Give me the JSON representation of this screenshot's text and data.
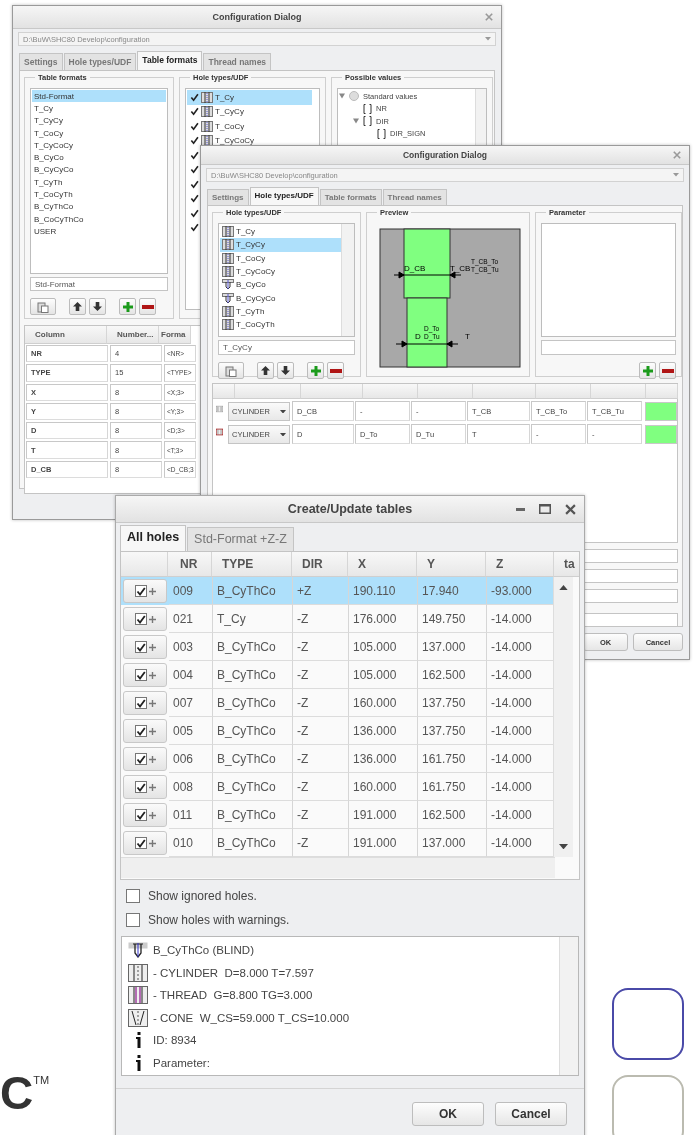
{
  "dialog_back": {
    "title": "Configuration Dialog",
    "path": "D:\\BuW\\SHC80 Develop\\configuration",
    "tabs": [
      {
        "label": "Settings",
        "selected": false
      },
      {
        "label": "Hole types/UDF",
        "selected": false
      },
      {
        "label": "Table formats",
        "selected": true
      },
      {
        "label": "Thread names",
        "selected": false
      }
    ],
    "table_formats": {
      "title": "Table formats",
      "name_value": "Std-Format",
      "items": [
        {
          "label": "Std-Format",
          "selected": true
        },
        {
          "label": "T_Cy",
          "selected": false
        },
        {
          "label": "T_CyCy",
          "selected": false
        },
        {
          "label": "T_CoCy",
          "selected": false
        },
        {
          "label": "T_CyCoCy",
          "selected": false
        },
        {
          "label": "B_CyCo",
          "selected": false
        },
        {
          "label": "B_CyCyCo",
          "selected": false
        },
        {
          "label": "T_CyTh",
          "selected": false
        },
        {
          "label": "T_CoCyTh",
          "selected": false
        },
        {
          "label": "B_CyThCo",
          "selected": false
        },
        {
          "label": "B_CoCyThCo",
          "selected": false
        },
        {
          "label": "USER",
          "selected": false
        }
      ]
    },
    "hole_types": {
      "title": "Hole types/UDF",
      "items": [
        {
          "label": "T_Cy",
          "kind": "through",
          "checked": true,
          "selected": true
        },
        {
          "label": "T_CyCy",
          "kind": "through",
          "checked": true,
          "selected": false
        },
        {
          "label": "T_CoCy",
          "kind": "through",
          "checked": true,
          "selected": false
        },
        {
          "label": "T_CyCoCy",
          "kind": "through",
          "checked": true,
          "selected": false
        },
        {
          "checked": true,
          "selected": false
        },
        {
          "checked": true,
          "selected": false
        },
        {
          "checked": true,
          "selected": false
        },
        {
          "checked": true,
          "selected": false
        },
        {
          "checked": true,
          "selected": false
        },
        {
          "checked": true,
          "selected": false
        }
      ]
    },
    "possible_values": {
      "title": "Possible values",
      "tree": [
        {
          "label": "Standard values",
          "expanded": true,
          "children": [
            {
              "label": "NR"
            },
            {
              "label": "DIR",
              "expanded": true,
              "children": [
                {
                  "label": "DIR_SIGN"
                }
              ]
            }
          ]
        }
      ]
    },
    "columns_table": {
      "columns": [
        "Column",
        "Number...",
        "Forma"
      ],
      "rows": [
        [
          "NR",
          "4",
          "<NR>"
        ],
        [
          "TYPE",
          "15",
          "<TYPE>"
        ],
        [
          "X",
          "8",
          "<X;3>"
        ],
        [
          "Y",
          "8",
          "<Y;3>"
        ],
        [
          "D",
          "8",
          "<D;3>"
        ],
        [
          "T",
          "8",
          "<T;3>"
        ],
        [
          "D_CB",
          "8",
          "<D_CB;3"
        ]
      ]
    }
  },
  "dialog_middle": {
    "title": "Configuration Dialog",
    "path": "D:\\BuW\\SHC80 Develop\\configuration",
    "tabs": [
      {
        "label": "Settings",
        "selected": false
      },
      {
        "label": "Hole types/UDF",
        "selected": true
      },
      {
        "label": "Table formats",
        "selected": false
      },
      {
        "label": "Thread names",
        "selected": false
      }
    ],
    "hole_types": {
      "title": "Hole types/UDF",
      "name_value": "T_CyCy",
      "items": [
        {
          "label": "T_Cy",
          "kind": "through",
          "selected": false
        },
        {
          "label": "T_CyCy",
          "kind": "through",
          "selected": true
        },
        {
          "label": "T_CoCy",
          "kind": "through",
          "selected": false
        },
        {
          "label": "T_CyCoCy",
          "kind": "through",
          "selected": false
        },
        {
          "label": "B_CyCo",
          "kind": "blind",
          "selected": false
        },
        {
          "label": "B_CyCyCo",
          "kind": "blind",
          "selected": false
        },
        {
          "label": "T_CyTh",
          "kind": "through",
          "selected": false
        },
        {
          "label": "T_CoCyTh",
          "kind": "through",
          "selected": false
        }
      ]
    },
    "preview": {
      "title": "Preview",
      "labels": [
        "D_CB",
        "T_CB",
        "T_CB_To",
        "T_CB_Tu",
        "D",
        "D_To",
        "D_Tu",
        "T"
      ]
    },
    "parameter": {
      "title": "Parameter"
    },
    "segments": [
      {
        "selected": false,
        "shape": "CYLINDER",
        "cells": [
          "D_CB",
          "-",
          "-",
          "T_CB",
          "T_CB_To",
          "T_CB_Tu"
        ]
      },
      {
        "selected": true,
        "shape": "CYLINDER",
        "cells": [
          "D",
          "D_To",
          "D_Tu",
          "T",
          "-",
          "-"
        ]
      }
    ],
    "buttons": [
      "OK",
      "Cancel"
    ]
  },
  "create_tables": {
    "title": "Create/Update tables",
    "tabs": [
      {
        "label": "All holes",
        "selected": true
      },
      {
        "label": "Std-Format +Z-Z",
        "selected": false
      }
    ],
    "columns": [
      "NR",
      "TYPE",
      "DIR",
      "X",
      "Y",
      "Z",
      "ta"
    ],
    "rows": [
      {
        "checked": true,
        "selected": true,
        "cells": [
          "009",
          "B_CyThCo",
          "+Z",
          "190.110",
          "17.940",
          "-93.000"
        ]
      },
      {
        "checked": true,
        "selected": false,
        "cells": [
          "021",
          "T_Cy",
          "-Z",
          "176.000",
          "149.750",
          "-14.000"
        ]
      },
      {
        "checked": true,
        "selected": false,
        "cells": [
          "003",
          "B_CyThCo",
          "-Z",
          "105.000",
          "137.000",
          "-14.000"
        ]
      },
      {
        "checked": true,
        "selected": false,
        "cells": [
          "004",
          "B_CyThCo",
          "-Z",
          "105.000",
          "162.500",
          "-14.000"
        ]
      },
      {
        "checked": true,
        "selected": false,
        "cells": [
          "007",
          "B_CyThCo",
          "-Z",
          "160.000",
          "137.750",
          "-14.000"
        ]
      },
      {
        "checked": true,
        "selected": false,
        "cells": [
          "005",
          "B_CyThCo",
          "-Z",
          "136.000",
          "137.750",
          "-14.000"
        ]
      },
      {
        "checked": true,
        "selected": false,
        "cells": [
          "006",
          "B_CyThCo",
          "-Z",
          "136.000",
          "161.750",
          "-14.000"
        ]
      },
      {
        "checked": true,
        "selected": false,
        "cells": [
          "008",
          "B_CyThCo",
          "-Z",
          "160.000",
          "161.750",
          "-14.000"
        ]
      },
      {
        "checked": true,
        "selected": false,
        "cells": [
          "011",
          "B_CyThCo",
          "-Z",
          "191.000",
          "162.500",
          "-14.000"
        ]
      },
      {
        "checked": true,
        "selected": false,
        "cells": [
          "010",
          "B_CyThCo",
          "-Z",
          "191.000",
          "137.000",
          "-14.000"
        ]
      }
    ],
    "options": [
      {
        "label": "Show ignored holes.",
        "checked": false
      },
      {
        "label": "Show holes with warnings.",
        "checked": false
      }
    ],
    "details": [
      {
        "kind": "blind",
        "text": "B_CyThCo (BLIND)"
      },
      {
        "kind": "cylinder",
        "text": "- CYLINDER  D=8.000 T=7.597"
      },
      {
        "kind": "thread",
        "text": "- THREAD  G=8.800 TG=3.000"
      },
      {
        "kind": "cone",
        "text": "- CONE  W_CS=59.000 T_CS=10.000"
      },
      {
        "kind": "info",
        "text": "ID: 8934"
      },
      {
        "kind": "info",
        "text": "Parameter:"
      }
    ],
    "buttons": [
      "OK",
      "Cancel"
    ]
  },
  "logo": {
    "letter": "C",
    "mark": "TM"
  }
}
